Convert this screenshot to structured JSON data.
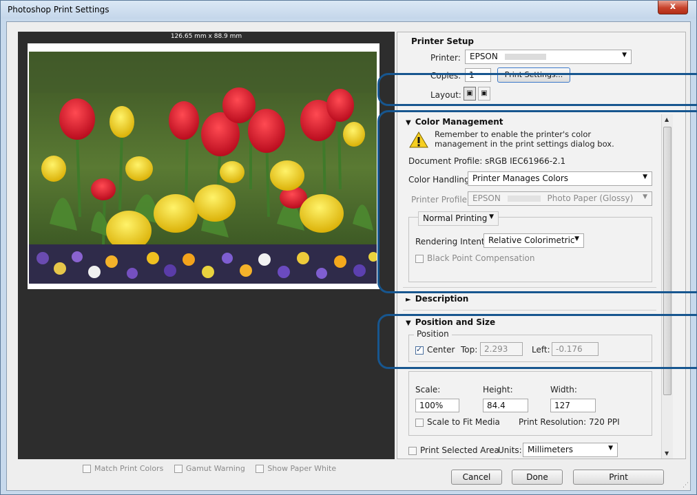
{
  "window": {
    "title": "Photoshop Print Settings",
    "close_glyph": "x"
  },
  "preview": {
    "dimension_label": "126.65 mm x 88.9 mm",
    "checks": [
      {
        "label": "Match Print Colors",
        "checked": false
      },
      {
        "label": "Gamut Warning",
        "checked": false
      },
      {
        "label": "Show Paper White",
        "checked": false
      }
    ]
  },
  "printer_setup": {
    "title": "Printer Setup",
    "printer_label": "Printer:",
    "printer_value": "EPSON",
    "copies_label": "Copies:",
    "copies_value": "1",
    "print_settings_button": "Print Settings...",
    "layout_label": "Layout:"
  },
  "color_management": {
    "title": "Color Management",
    "warning_line1": "Remember to enable the printer's color",
    "warning_line2": "management in the print settings dialog box.",
    "document_profile": "Document Profile: sRGB IEC61966-2.1",
    "color_handling_label": "Color Handling:",
    "color_handling_value": "Printer Manages Colors",
    "printer_profile_label": "Printer Profile:",
    "printer_profile_value": "EPSON",
    "printer_profile_value2": "Photo Paper (Glossy)",
    "normal_printing": "Normal Printing",
    "rendering_intent_label": "Rendering Intent:",
    "rendering_intent_value": "Relative Colorimetric",
    "black_point": "Black Point Compensation"
  },
  "description": {
    "title": "Description"
  },
  "position_size": {
    "title": "Position and Size",
    "position_legend": "Position",
    "center_label": "Center",
    "top_label": "Top:",
    "top_value": "2.293",
    "left_label": "Left:",
    "left_value": "-0.176",
    "scale_label": "Scale:",
    "scale_value": "100%",
    "height_label": "Height:",
    "height_value": "84.4",
    "width_label": "Width:",
    "width_value": "127",
    "fit_media": "Scale to Fit Media",
    "resolution": "Print Resolution: 720 PPI"
  },
  "print_area": {
    "label": "Print Selected Area",
    "units_label": "Units:",
    "units_value": "Millimeters"
  },
  "buttons": {
    "cancel": "Cancel",
    "done": "Done",
    "print": "Print"
  },
  "colors": {
    "highlight": "#17568f",
    "accent": "#3a78c9"
  }
}
